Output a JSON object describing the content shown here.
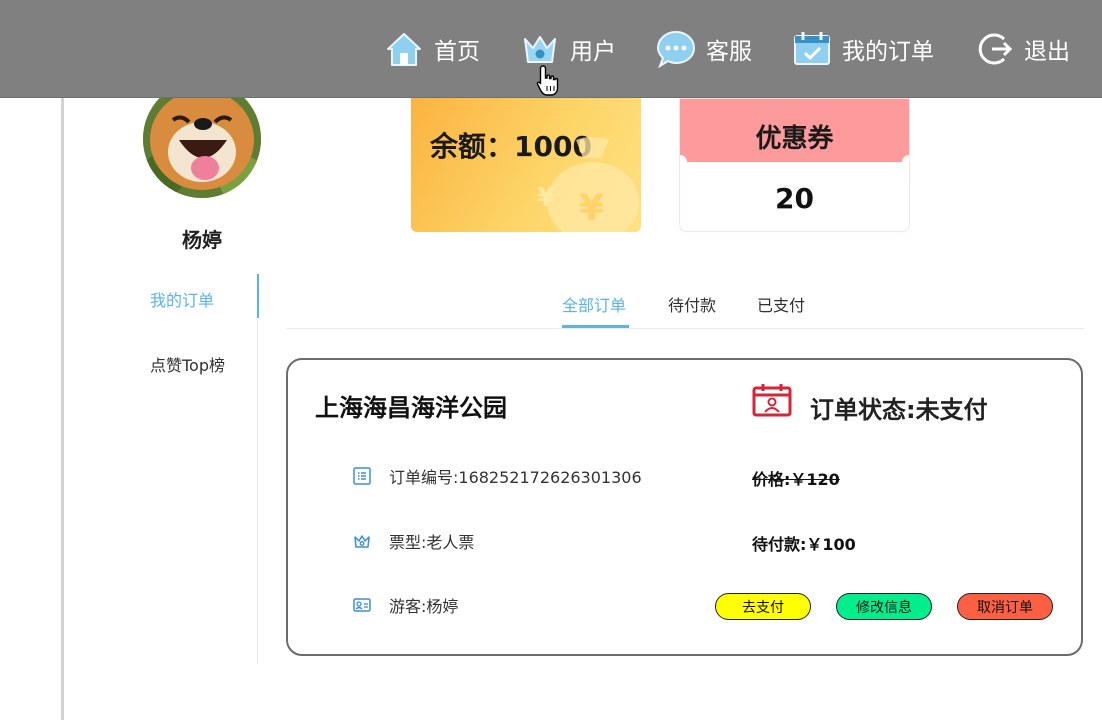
{
  "nav": {
    "items": [
      {
        "label": "首页",
        "icon": "home-icon"
      },
      {
        "label": "用户",
        "icon": "crown-icon"
      },
      {
        "label": "客服",
        "icon": "chat-bubble-icon"
      },
      {
        "label": "我的订单",
        "icon": "calendar-check-icon"
      },
      {
        "label": "退出",
        "icon": "logout-icon"
      }
    ]
  },
  "profile": {
    "name": "杨婷"
  },
  "balance": {
    "text": "余额：1000"
  },
  "coupon": {
    "title": "优惠券",
    "count": "20"
  },
  "side_menu": {
    "items": [
      {
        "label": "我的订单"
      },
      {
        "label": "点赞Top榜"
      }
    ]
  },
  "tabs": [
    {
      "label": "全部订单"
    },
    {
      "label": "待付款"
    },
    {
      "label": "已支付"
    }
  ],
  "order": {
    "park": "上海海昌海洋公园",
    "status": "订单状态:未支付",
    "order_no": "订单编号:168252172626301306",
    "ticket_type": "票型:老人票",
    "visitor": "游客:杨婷",
    "price": "价格:￥120",
    "due": "待付款:￥100",
    "buttons": {
      "pay": "去支付",
      "edit": "修改信息",
      "cancel": "取消订单"
    }
  },
  "colors": {
    "nav_bg": "#808080",
    "accent": "#5ab4e5",
    "coupon_header": "#fc9a9c",
    "pay_button": "#ffff00",
    "edit_button": "#00ee8c",
    "cancel_button": "#fd5f43",
    "status_icon": "#d6253a"
  }
}
